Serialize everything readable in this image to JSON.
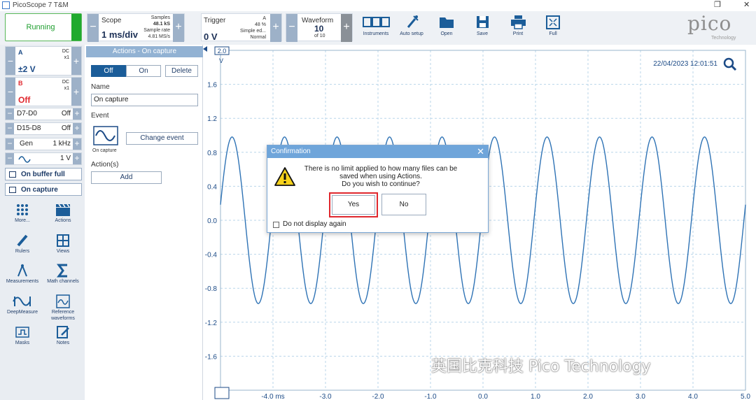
{
  "window": {
    "title": "PicoScope 7 T&M",
    "restore_glyph": "❐",
    "close_glyph": "✕"
  },
  "toolbar": {
    "run_label": "Running",
    "scope": {
      "title": "Scope",
      "timebase": "1 ms/div",
      "samples_label": "Samples",
      "samples_value": "48.1 kS",
      "rate_label": "Sample rate",
      "rate_value": "4.81 MS/s"
    },
    "trigger": {
      "title": "Trigger",
      "channel": "A",
      "level": "0 V",
      "percent": "48 %",
      "mode_line1": "Simple ed...",
      "mode_line2": "Normal"
    },
    "waveform": {
      "title": "Waveform",
      "current": "10",
      "of": "of 10"
    },
    "tools": [
      "Instruments",
      "Auto setup",
      "Open",
      "Save",
      "Print",
      "Full"
    ],
    "logo": "pico",
    "logo_sub": "Technology"
  },
  "sidebar": {
    "channel_a": {
      "name": "A",
      "coupling": "DC",
      "probe": "x1",
      "range": "±2 V"
    },
    "channel_b": {
      "name": "B",
      "coupling": "DC",
      "probe": "x1",
      "state": "Off"
    },
    "digital": [
      {
        "label": "D7-D0",
        "state": "Off"
      },
      {
        "label": "D15-D8",
        "state": "Off"
      }
    ],
    "gen": {
      "label": "Gen",
      "freq": "1 kHz",
      "amp": "1 V"
    },
    "action_buttons": [
      "On buffer full",
      "On capture"
    ],
    "tools": [
      {
        "icon": "more-icon",
        "label": "More..."
      },
      {
        "icon": "actions-icon",
        "label": "Actions"
      },
      {
        "icon": "rulers-icon",
        "label": "Rulers"
      },
      {
        "icon": "views-icon",
        "label": "Views"
      },
      {
        "icon": "measurements-icon",
        "label": "Measurements"
      },
      {
        "icon": "math-channels-icon",
        "label": "Math channels"
      },
      {
        "icon": "deepmeasure-icon",
        "label": "DeepMeasure"
      },
      {
        "icon": "reference-waveforms-icon",
        "label": "Reference waveforms"
      },
      {
        "icon": "masks-icon",
        "label": "Masks"
      },
      {
        "icon": "notes-icon",
        "label": "Notes"
      }
    ]
  },
  "panel": {
    "title": "Actions - On capture",
    "off": "Off",
    "on": "On",
    "delete": "Delete",
    "name_label": "Name",
    "name_value": "On capture",
    "event_label": "Event",
    "event_name": "On capture",
    "change_event": "Change event",
    "actions_label": "Action(s)",
    "add": "Add"
  },
  "plot": {
    "timestamp": "22/04/2023 12:01:51",
    "unit": "V",
    "range_box": "2.0",
    "y_ticks": [
      "1.6",
      "1.2",
      "0.8",
      "0.4",
      "0.0",
      "-0.4",
      "-0.8",
      "-1.2",
      "-1.6"
    ],
    "x_ticks": [
      "-4.0 ms",
      "-3.0",
      "-2.0",
      "-1.0",
      "0.0",
      "1.0",
      "2.0",
      "3.0",
      "4.0",
      "5.0"
    ]
  },
  "dialog": {
    "title": "Confirmation",
    "message_1": "There is no limit applied to how many files can be",
    "message_2": "saved when using Actions.",
    "message_3": "Do you wish to continue?",
    "yes": "Yes",
    "no": "No",
    "checkbox_label": "Do not display again"
  },
  "watermark": "英国比克科技 Pico Technology",
  "colors": {
    "accent": "#1b5d99",
    "running": "#1faa2e",
    "channel_b": "#e0282e",
    "trace": "#2f73b5",
    "highlight": "#e0282e"
  }
}
